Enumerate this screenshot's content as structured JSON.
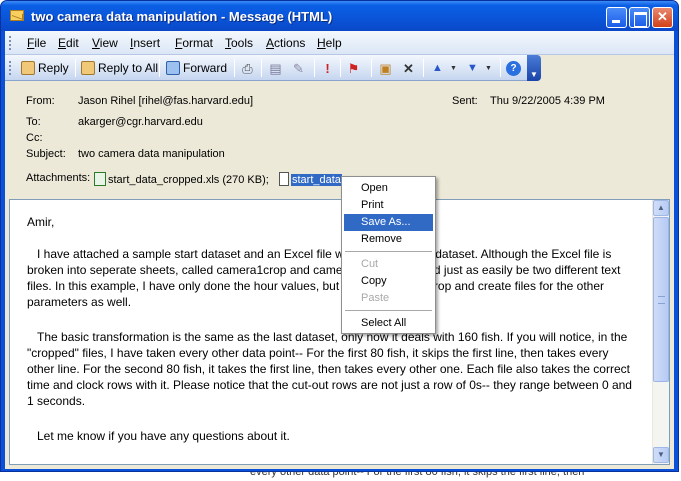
{
  "window": {
    "title": "two camera data manipulation - Message (HTML)"
  },
  "menu": [
    {
      "label": "File",
      "u": "F",
      "rest": "ile"
    },
    {
      "label": "Edit",
      "u": "E",
      "rest": "dit"
    },
    {
      "label": "View",
      "u": "V",
      "rest": "iew"
    },
    {
      "label": "Insert",
      "u": "I",
      "rest": "nsert"
    },
    {
      "label": "Format",
      "u": "F",
      "rest": "ormat"
    },
    {
      "label": "Tools",
      "u": "T",
      "rest": "ools"
    },
    {
      "label": "Actions",
      "u": "A",
      "rest": "ctions"
    },
    {
      "label": "Help",
      "u": "H",
      "rest": "elp"
    }
  ],
  "toolbar": {
    "reply_label": "Reply",
    "reply_all_label": "Reply to All",
    "forward_label": "Forward"
  },
  "header": {
    "from_label": "From:",
    "from_value": "Jason Rihel [rihel@fas.harvard.edu]",
    "sent_label": "Sent:",
    "sent_value": "Thu 9/22/2005 4:39 PM",
    "to_label": "To:",
    "to_value": "akarger@cgr.harvard.edu",
    "cc_label": "Cc:",
    "cc_value": "",
    "subject_label": "Subject:",
    "subject_value": "two camera data manipulation",
    "attachments_label": "Attachments:",
    "attachment1": "start_data_cropped.xls (270 KB);",
    "attachment2": "start_data"
  },
  "context_menu": {
    "open": "Open",
    "print": "Print",
    "save_as": "Save As...",
    "remove": "Remove",
    "cut": "Cut",
    "copy": "Copy",
    "paste": "Paste",
    "select_all": "Select All"
  },
  "body": {
    "greeting": "Amir,",
    "para1": "I have attached a sample start dataset and an Excel file with a sample end dataset.  Although the Excel file is broken into seperate sheets, called camera1crop and camera2crop, this could just as easily be two different text files.  In this example, I have only done the hour values, but I would like it to crop and create files for the other parameters as well.",
    "para2": "The basic transformation is the same as the last dataset, only now it deals with 160 fish.  If you will notice, in the \"cropped\" files, I have taken every other data point--  For the first 80 fish, it skips the first line, then takes every other line.  For the second 80 fish, it takes the first line, then takes every other one.  Each file also takes the correct time and clock rows with it.  Please notice that the cut-out rows are not just a row of 0s-- they range between 0 and 1 seconds.",
    "para3": "Let me know if you have any questions about it."
  },
  "desktop": {
    "background_text": "every other data point--  For the first 80 fish, it skips the first line, then"
  },
  "colors": {
    "titlebar": "#0a54d8",
    "selection": "#316ac5"
  }
}
